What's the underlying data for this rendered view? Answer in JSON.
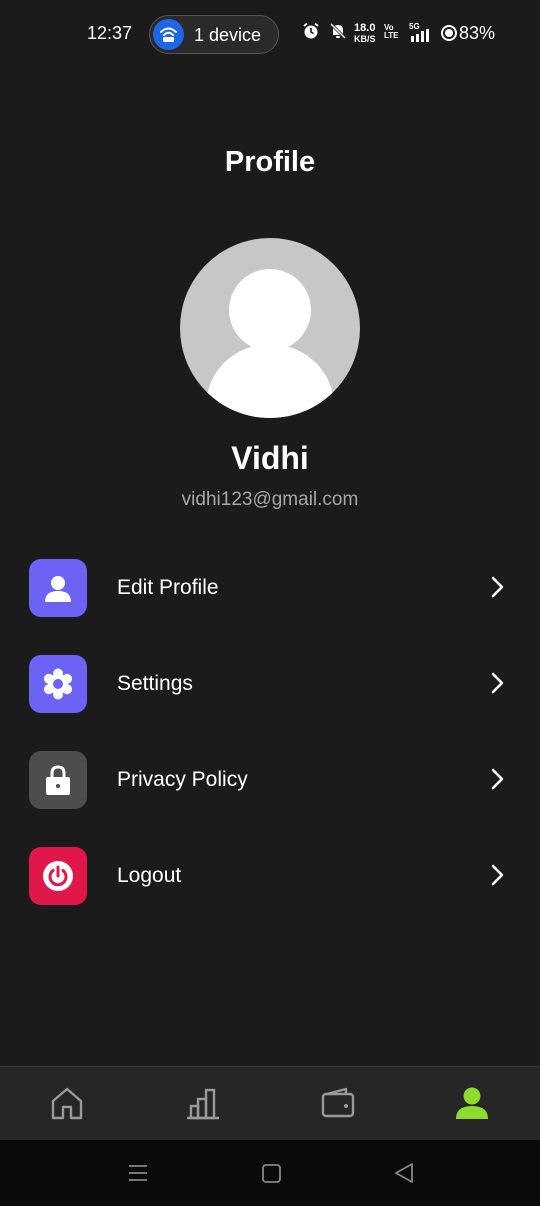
{
  "status_bar": {
    "time": "12:37",
    "hotspot_label": "1 device",
    "net_speed_value": "18.0",
    "net_speed_unit": "KB/S",
    "volte_top": "Vo",
    "volte_bottom": "LTE",
    "network_type": "5G",
    "battery": "83%"
  },
  "header": {
    "title": "Profile"
  },
  "profile": {
    "name": "Vidhi",
    "email": "vidhi123@gmail.com"
  },
  "menu": [
    {
      "label": "Edit Profile",
      "icon": "person-icon",
      "color": "#6c63f5"
    },
    {
      "label": "Settings",
      "icon": "gear-icon",
      "color": "#6c63f5"
    },
    {
      "label": "Privacy Policy",
      "icon": "lock-icon",
      "color": "#4d4d4d"
    },
    {
      "label": "Logout",
      "icon": "power-icon",
      "color": "#e0174a"
    }
  ],
  "bottom_nav": [
    {
      "icon": "home-icon",
      "active": false
    },
    {
      "icon": "chart-icon",
      "active": false
    },
    {
      "icon": "wallet-icon",
      "active": false
    },
    {
      "icon": "profile-icon",
      "active": true,
      "color": "#8ddc2c"
    }
  ],
  "system_nav": [
    "recents-icon",
    "home-square-icon",
    "back-triangle-icon"
  ]
}
